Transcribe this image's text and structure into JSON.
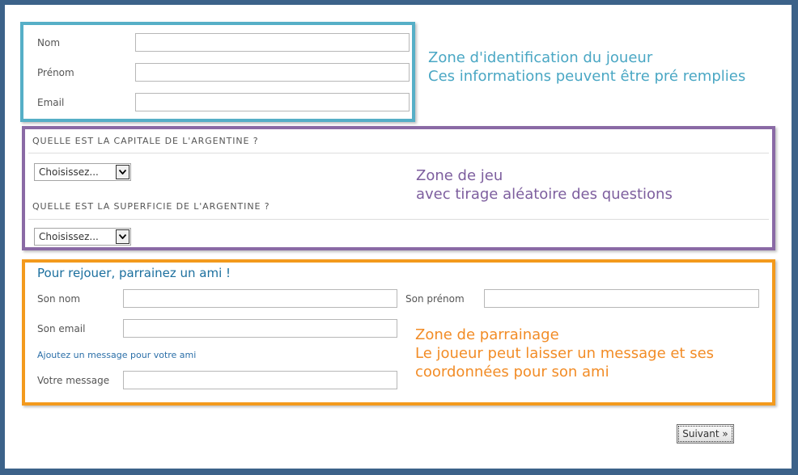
{
  "identification": {
    "fields": [
      {
        "label": "Nom",
        "value": ""
      },
      {
        "label": "Prénom",
        "value": ""
      },
      {
        "label": "Email",
        "value": ""
      }
    ],
    "note_lines": [
      "Zone d'identification du joueur",
      "Ces informations peuvent être pré remplies"
    ]
  },
  "game": {
    "questions": [
      {
        "text": "QUELLE EST LA CAPITALE DE L'ARGENTINE ?",
        "select_value": "Choisissez..."
      },
      {
        "text": "QUELLE EST LA SUPERFICIE DE L'ARGENTINE ?",
        "select_value": "Choisissez..."
      }
    ],
    "note_lines": [
      "Zone de jeu",
      "avec tirage aléatoire des questions"
    ]
  },
  "sponsorship": {
    "title": "Pour rejouer, parrainez un ami !",
    "nom_label": "Son nom",
    "prenom_label": "Son prénom",
    "email_label": "Son email",
    "add_message_link": "Ajoutez un message pour votre ami",
    "message_label": "Votre message",
    "note_lines": [
      "Zone de parrainage",
      "Le joueur peut laisser un message et ses",
      "coordonnées pour son ami"
    ]
  },
  "next_button": "Suivant »",
  "colors": {
    "frame": "#3c6289",
    "zone_identification": "#56afc7",
    "zone_game": "#8a6aa5",
    "zone_sponsorship": "#f39a1d",
    "link": "#2b6fa8"
  },
  "icons": {
    "select_arrow": "chevron-down-icon"
  }
}
